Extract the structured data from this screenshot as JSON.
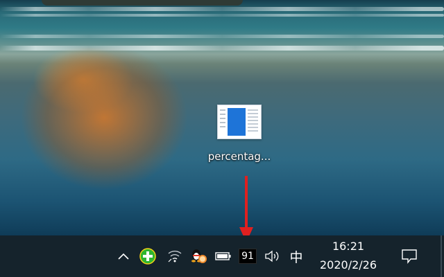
{
  "desktop": {
    "icon_label": "percentag..."
  },
  "taskbar": {
    "cpu_badge_value": "91",
    "ime_label": "中",
    "clock": {
      "time": "16:21",
      "date": "2020/2/26"
    }
  },
  "icons": {
    "tray_overflow": "chevron-up-icon",
    "addon": "green-plus-icon",
    "network": "wifi-icon",
    "qq": "qq-penguin-icon",
    "battery": "battery-icon",
    "volume": "speaker-icon",
    "notifications": "action-center-icon"
  },
  "colors": {
    "taskbar_bg": "#15232c",
    "annotation_arrow": "#e02020",
    "doc_accent": "#1e74d8",
    "addon_green": "#2fb52f",
    "addon_yellow": "#f5d316"
  }
}
